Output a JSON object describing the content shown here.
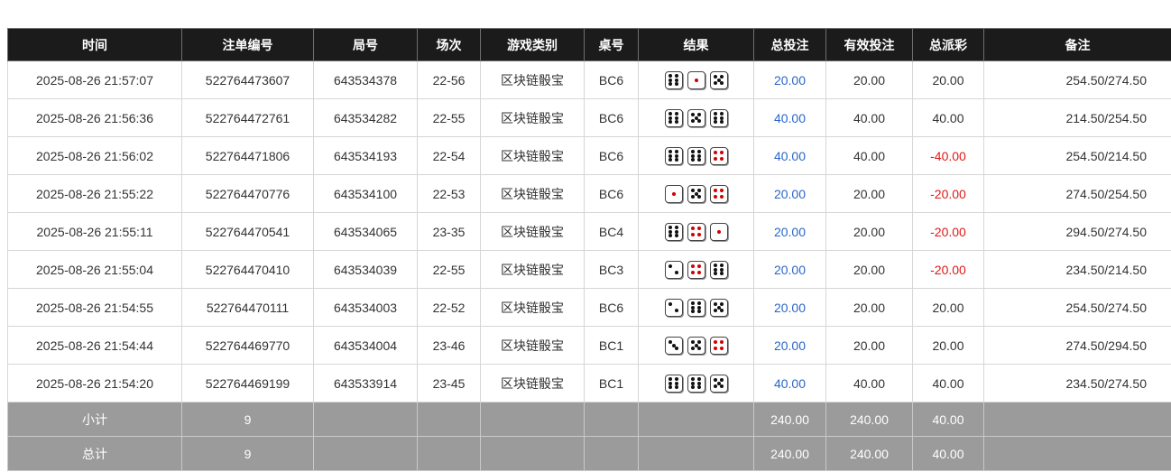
{
  "headers": [
    "时间",
    "注单编号",
    "局号",
    "场次",
    "游戏类别",
    "桌号",
    "结果",
    "总投注",
    "有效投注",
    "总派彩",
    "备注"
  ],
  "rows": [
    {
      "time": "2025-08-26 21:57:07",
      "bet_id": "522764473607",
      "round": "643534378",
      "session": "22-56",
      "game": "区块链骰宝",
      "table": "BC6",
      "dice": [
        6,
        1,
        5
      ],
      "total_bet": "20.00",
      "valid_bet": "20.00",
      "payout": "20.00",
      "payout_negative": false,
      "remark": "254.50/274.50"
    },
    {
      "time": "2025-08-26 21:56:36",
      "bet_id": "522764472761",
      "round": "643534282",
      "session": "22-55",
      "game": "区块链骰宝",
      "table": "BC6",
      "dice": [
        6,
        5,
        6
      ],
      "total_bet": "40.00",
      "valid_bet": "40.00",
      "payout": "40.00",
      "payout_negative": false,
      "remark": "214.50/254.50"
    },
    {
      "time": "2025-08-26 21:56:02",
      "bet_id": "522764471806",
      "round": "643534193",
      "session": "22-54",
      "game": "区块链骰宝",
      "table": "BC6",
      "dice": [
        6,
        6,
        4
      ],
      "total_bet": "40.00",
      "valid_bet": "40.00",
      "payout": "-40.00",
      "payout_negative": true,
      "remark": "254.50/214.50"
    },
    {
      "time": "2025-08-26 21:55:22",
      "bet_id": "522764470776",
      "round": "643534100",
      "session": "22-53",
      "game": "区块链骰宝",
      "table": "BC6",
      "dice": [
        1,
        5,
        4
      ],
      "total_bet": "20.00",
      "valid_bet": "20.00",
      "payout": "-20.00",
      "payout_negative": true,
      "remark": "274.50/254.50"
    },
    {
      "time": "2025-08-26 21:55:11",
      "bet_id": "522764470541",
      "round": "643534065",
      "session": "23-35",
      "game": "区块链骰宝",
      "table": "BC4",
      "dice": [
        6,
        4,
        1
      ],
      "total_bet": "20.00",
      "valid_bet": "20.00",
      "payout": "-20.00",
      "payout_negative": true,
      "remark": "294.50/274.50"
    },
    {
      "time": "2025-08-26 21:55:04",
      "bet_id": "522764470410",
      "round": "643534039",
      "session": "22-55",
      "game": "区块链骰宝",
      "table": "BC3",
      "dice": [
        2,
        4,
        6
      ],
      "total_bet": "20.00",
      "valid_bet": "20.00",
      "payout": "-20.00",
      "payout_negative": true,
      "remark": "234.50/214.50"
    },
    {
      "time": "2025-08-26 21:54:55",
      "bet_id": "522764470111",
      "round": "643534003",
      "session": "22-52",
      "game": "区块链骰宝",
      "table": "BC6",
      "dice": [
        2,
        6,
        5
      ],
      "total_bet": "20.00",
      "valid_bet": "20.00",
      "payout": "20.00",
      "payout_negative": false,
      "remark": "254.50/274.50"
    },
    {
      "time": "2025-08-26 21:54:44",
      "bet_id": "522764469770",
      "round": "643534004",
      "session": "23-46",
      "game": "区块链骰宝",
      "table": "BC1",
      "dice": [
        3,
        5,
        4
      ],
      "total_bet": "20.00",
      "valid_bet": "20.00",
      "payout": "20.00",
      "payout_negative": false,
      "remark": "274.50/294.50"
    },
    {
      "time": "2025-08-26 21:54:20",
      "bet_id": "522764469199",
      "round": "643533914",
      "session": "23-45",
      "game": "区块链骰宝",
      "table": "BC1",
      "dice": [
        6,
        6,
        5
      ],
      "total_bet": "40.00",
      "valid_bet": "40.00",
      "payout": "40.00",
      "payout_negative": false,
      "remark": "234.50/274.50"
    }
  ],
  "summary": [
    {
      "label": "小计",
      "count": "9",
      "total_bet": "240.00",
      "valid_bet": "240.00",
      "payout": "40.00"
    },
    {
      "label": "总计",
      "count": "9",
      "total_bet": "240.00",
      "valid_bet": "240.00",
      "payout": "40.00"
    }
  ],
  "colors": {
    "header_bg": "#1b1b1b",
    "summary_bg": "#9b9b9b",
    "bet_blue": "#2a66c8",
    "loss_red": "#e01818",
    "red_pip": "#d10000"
  }
}
